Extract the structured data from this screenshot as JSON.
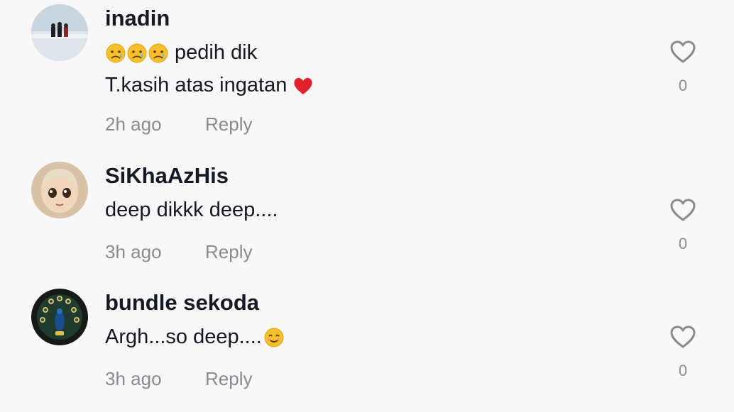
{
  "comments": [
    {
      "username": "inadin",
      "line1_emoji": [
        "sad-tear-emoji",
        "sad-tear-emoji",
        "sad-tear-emoji"
      ],
      "line1_text": "pedih dik",
      "line2_text": "T.kasih atas ingatan",
      "line2_emoji": "red-heart-emoji",
      "time": "2h ago",
      "reply": "Reply",
      "likes": "0"
    },
    {
      "username": "SiKhaAzHis",
      "text": "deep dikkk deep....",
      "time": "3h ago",
      "reply": "Reply",
      "likes": "0"
    },
    {
      "username": "bundle sekoda",
      "text": "Argh...so deep....",
      "text_emoji": "smiling-face-emoji",
      "time": "3h ago",
      "reply": "Reply",
      "likes": "0"
    }
  ],
  "colors": {
    "background": "#f8f8f8",
    "text_primary": "#161823",
    "text_secondary": "#8a8b91",
    "heart_outline": "#8a8b91"
  }
}
